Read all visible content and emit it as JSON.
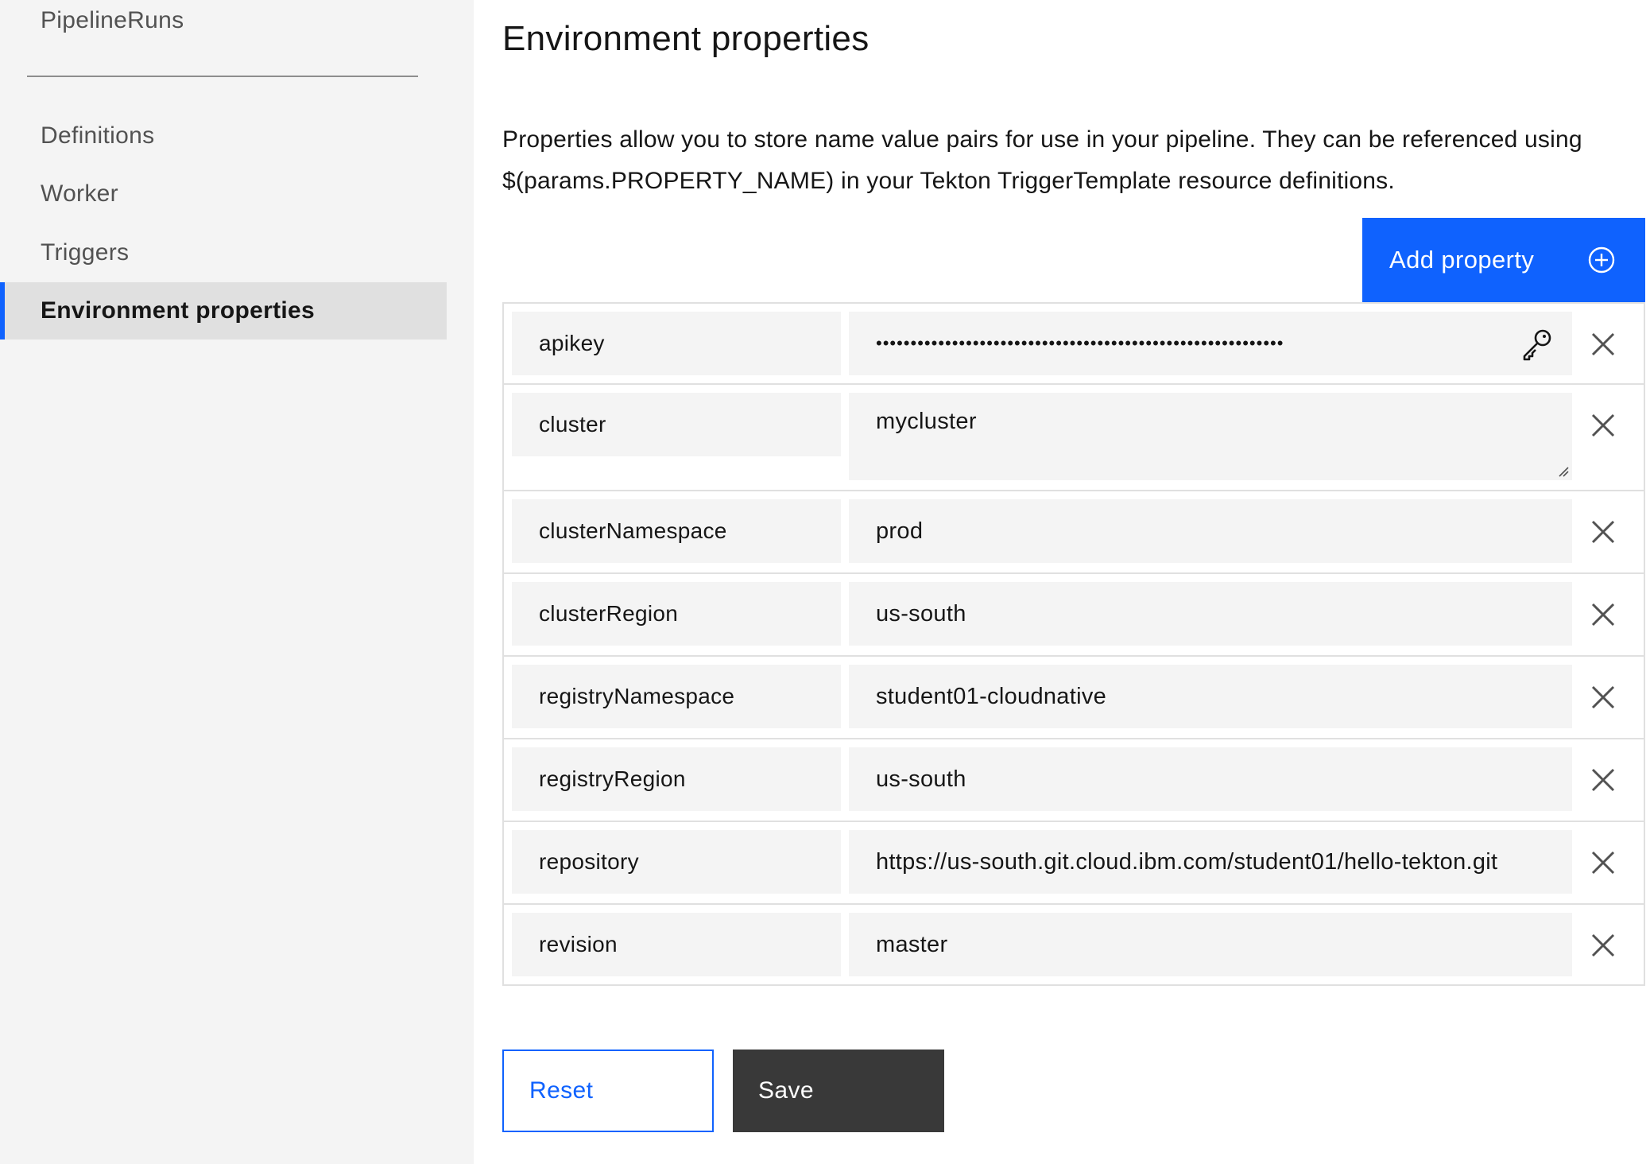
{
  "sidebar": {
    "items": [
      {
        "label": "PipelineRuns"
      },
      {
        "label": "Definitions"
      },
      {
        "label": "Worker"
      },
      {
        "label": "Triggers"
      },
      {
        "label": "Environment properties",
        "active": true
      }
    ]
  },
  "main": {
    "title": "Environment properties",
    "description": "Properties allow you to store name value pairs for use in your pipeline. They can be referenced using $(params.PROPERTY_NAME) in your Tekton TriggerTemplate resource definitions.",
    "add_button_label": "Add property",
    "add_button_icon": "add-circle-icon",
    "properties": [
      {
        "name": "apikey",
        "value": "•••••••••••••••••••••••••••••••••••••••••••••••••••••••••••",
        "type": "secure",
        "icon": "key-icon"
      },
      {
        "name": "cluster",
        "value": "mycluster",
        "type": "text-area"
      },
      {
        "name": "clusterNamespace",
        "value": "prod",
        "type": "text"
      },
      {
        "name": "clusterRegion",
        "value": "us-south",
        "type": "text"
      },
      {
        "name": "registryNamespace",
        "value": "student01-cloudnative",
        "type": "text"
      },
      {
        "name": "registryRegion",
        "value": "us-south",
        "type": "text"
      },
      {
        "name": "repository",
        "value": "https://us-south.git.cloud.ibm.com/student01/hello-tekton.git",
        "type": "text"
      },
      {
        "name": "revision",
        "value": "master",
        "type": "text"
      }
    ],
    "reset_label": "Reset",
    "save_label": "Save"
  },
  "colors": {
    "primary": "#0f62fe",
    "save_button": "#393939",
    "field_bg": "#f4f4f4",
    "sidebar_bg": "#f4f4f4",
    "active_nav_bg": "#e0e0e0"
  }
}
